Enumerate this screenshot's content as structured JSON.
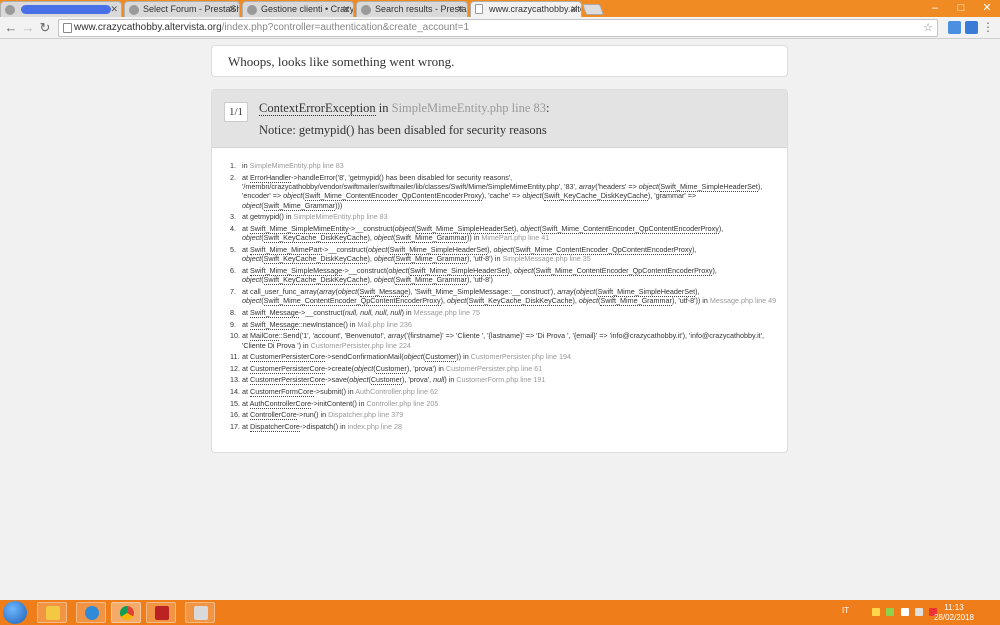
{
  "browser": {
    "tabs": [
      {
        "title": ""
      },
      {
        "title": "Select Forum - PrestaSh"
      },
      {
        "title": "Gestione clienti • Crazy C"
      },
      {
        "title": "Search results - PrestaSh"
      },
      {
        "title": "www.crazycathobby.alterv"
      }
    ],
    "url_host": "www.crazycathobby.altervista.org",
    "url_path": "/index.php?controller=authentication&create_account=1"
  },
  "page": {
    "whoops": "Whoops, looks like something went wrong.",
    "exception": {
      "counter": "1/1",
      "class": "ContextErrorException",
      "in": "in",
      "file": "SimpleMimeEntity.php line 83",
      "colon": ":",
      "message": "Notice: getmypid() has been disabled for security reasons"
    }
  },
  "stack_trace": [
    {
      "n": "1.",
      "parts": [
        [
          "t",
          "in "
        ],
        [
          "g",
          "SimpleMimeEntity.php line 83"
        ]
      ]
    },
    {
      "n": "2.",
      "parts": [
        [
          "t",
          "at "
        ],
        [
          "u",
          "ErrorHandler"
        ],
        [
          "t",
          "->handleError('8', 'getmypid() has been disabled for security reasons', '/membri/crazycathobby/vendor/swiftmailer/swiftmailer/lib/classes/Swift/Mime/SimpleMimeEntity.php', '83', "
        ],
        [
          "i",
          "array"
        ],
        [
          "t",
          "('headers' => "
        ],
        [
          "i",
          "object"
        ],
        [
          "t",
          "("
        ],
        [
          "u",
          "Swift_Mime_SimpleHeaderSet"
        ],
        [
          "t",
          "), 'encoder' => "
        ],
        [
          "i",
          "object"
        ],
        [
          "t",
          "("
        ],
        [
          "u",
          "Swift_Mime_ContentEncoder_QpContentEncoderProxy"
        ],
        [
          "t",
          "), 'cache' => "
        ],
        [
          "i",
          "object"
        ],
        [
          "t",
          "("
        ],
        [
          "u",
          "Swift_KeyCache_DiskKeyCache"
        ],
        [
          "t",
          "), 'grammar' => "
        ],
        [
          "i",
          "object"
        ],
        [
          "t",
          "("
        ],
        [
          "u",
          "Swift_Mime_Grammar"
        ],
        [
          "t",
          ")))"
        ]
      ]
    },
    {
      "n": "3.",
      "parts": [
        [
          "t",
          "at getmypid() in "
        ],
        [
          "g",
          "SimpleMimeEntity.php line 83"
        ]
      ]
    },
    {
      "n": "4.",
      "parts": [
        [
          "t",
          "at "
        ],
        [
          "u",
          "Swift_Mime_SimpleMimeEntity"
        ],
        [
          "t",
          "->__construct("
        ],
        [
          "i",
          "object"
        ],
        [
          "t",
          "("
        ],
        [
          "u",
          "Swift_Mime_SimpleHeaderSet"
        ],
        [
          "t",
          "), "
        ],
        [
          "i",
          "object"
        ],
        [
          "t",
          "("
        ],
        [
          "u",
          "Swift_Mime_ContentEncoder_QpContentEncoderProxy"
        ],
        [
          "t",
          "), "
        ],
        [
          "i",
          "object"
        ],
        [
          "t",
          "("
        ],
        [
          "u",
          "Swift_KeyCache_DiskKeyCache"
        ],
        [
          "t",
          "), "
        ],
        [
          "i",
          "object"
        ],
        [
          "t",
          "("
        ],
        [
          "u",
          "Swift_Mime_Grammar"
        ],
        [
          "t",
          ")) in "
        ],
        [
          "g",
          "MimePart.php line 41"
        ]
      ]
    },
    {
      "n": "5.",
      "parts": [
        [
          "t",
          "at "
        ],
        [
          "u",
          "Swift_Mime_MimePart"
        ],
        [
          "t",
          "->__construct("
        ],
        [
          "i",
          "object"
        ],
        [
          "t",
          "("
        ],
        [
          "u",
          "Swift_Mime_SimpleHeaderSet"
        ],
        [
          "t",
          "), "
        ],
        [
          "i",
          "object"
        ],
        [
          "t",
          "("
        ],
        [
          "u",
          "Swift_Mime_ContentEncoder_QpContentEncoderProxy"
        ],
        [
          "t",
          "), "
        ],
        [
          "i",
          "object"
        ],
        [
          "t",
          "("
        ],
        [
          "u",
          "Swift_KeyCache_DiskKeyCache"
        ],
        [
          "t",
          "), "
        ],
        [
          "i",
          "object"
        ],
        [
          "t",
          "("
        ],
        [
          "u",
          "Swift_Mime_Grammar"
        ],
        [
          "t",
          "), 'utf-8') in "
        ],
        [
          "g",
          "SimpleMessage.php line 35"
        ]
      ]
    },
    {
      "n": "6.",
      "parts": [
        [
          "t",
          "at "
        ],
        [
          "u",
          "Swift_Mime_SimpleMessage"
        ],
        [
          "t",
          "->__construct("
        ],
        [
          "i",
          "object"
        ],
        [
          "t",
          "("
        ],
        [
          "u",
          "Swift_Mime_SimpleHeaderSet"
        ],
        [
          "t",
          "), "
        ],
        [
          "i",
          "object"
        ],
        [
          "t",
          "("
        ],
        [
          "u",
          "Swift_Mime_ContentEncoder_QpContentEncoderProxy"
        ],
        [
          "t",
          "), "
        ],
        [
          "i",
          "object"
        ],
        [
          "t",
          "("
        ],
        [
          "u",
          "Swift_KeyCache_DiskKeyCache"
        ],
        [
          "t",
          "), "
        ],
        [
          "i",
          "object"
        ],
        [
          "t",
          "("
        ],
        [
          "u",
          "Swift_Mime_Grammar"
        ],
        [
          "t",
          "), 'utf-8')"
        ]
      ]
    },
    {
      "n": "7.",
      "parts": [
        [
          "t",
          "at call_user_func_array("
        ],
        [
          "i",
          "array"
        ],
        [
          "t",
          "("
        ],
        [
          "i",
          "object"
        ],
        [
          "t",
          "("
        ],
        [
          "u",
          "Swift_Message"
        ],
        [
          "t",
          "), 'Swift_Mime_SimpleMessage::__construct'), "
        ],
        [
          "i",
          "array"
        ],
        [
          "t",
          "("
        ],
        [
          "i",
          "object"
        ],
        [
          "t",
          "("
        ],
        [
          "u",
          "Swift_Mime_SimpleHeaderSet"
        ],
        [
          "t",
          "), "
        ],
        [
          "i",
          "object"
        ],
        [
          "t",
          "("
        ],
        [
          "u",
          "Swift_Mime_ContentEncoder_QpContentEncoderProxy"
        ],
        [
          "t",
          "), "
        ],
        [
          "i",
          "object"
        ],
        [
          "t",
          "("
        ],
        [
          "u",
          "Swift_KeyCache_DiskKeyCache"
        ],
        [
          "t",
          "), "
        ],
        [
          "i",
          "object"
        ],
        [
          "t",
          "("
        ],
        [
          "u",
          "Swift_Mime_Grammar"
        ],
        [
          "t",
          "), 'utf-8')) in "
        ],
        [
          "g",
          "Message.php line 49"
        ]
      ]
    },
    {
      "n": "8.",
      "parts": [
        [
          "t",
          "at "
        ],
        [
          "u",
          "Swift_Message"
        ],
        [
          "t",
          "->__construct("
        ],
        [
          "i",
          "null, null, null, null"
        ],
        [
          "t",
          ") in "
        ],
        [
          "g",
          "Message.php line 75"
        ]
      ]
    },
    {
      "n": "9.",
      "parts": [
        [
          "t",
          "at "
        ],
        [
          "u",
          "Swift_Message"
        ],
        [
          "t",
          "::newInstance() in "
        ],
        [
          "g",
          "Mail.php line 236"
        ]
      ]
    },
    {
      "n": "10.",
      "parts": [
        [
          "t",
          "at "
        ],
        [
          "u",
          "MailCore"
        ],
        [
          "t",
          "::Send('1', 'account', 'Benvenuto!', "
        ],
        [
          "i",
          "array"
        ],
        [
          "t",
          "('{firstname}' => 'Cliente ', '{lastname}' => 'Di Prova ', '{email}' => 'info@crazycathobby.it'), 'info@crazycathobby.it', 'Cliente Di Prova ') in "
        ],
        [
          "g",
          "CustomerPersister.php line 224"
        ]
      ]
    },
    {
      "n": "11.",
      "parts": [
        [
          "t",
          "at "
        ],
        [
          "u",
          "CustomerPersisterCore"
        ],
        [
          "t",
          "->sendConfirmationMail("
        ],
        [
          "i",
          "object"
        ],
        [
          "t",
          "("
        ],
        [
          "u",
          "Customer"
        ],
        [
          "t",
          ")) in "
        ],
        [
          "g",
          "CustomerPersister.php line 194"
        ]
      ]
    },
    {
      "n": "12.",
      "parts": [
        [
          "t",
          "at "
        ],
        [
          "u",
          "CustomerPersisterCore"
        ],
        [
          "t",
          "->create("
        ],
        [
          "i",
          "object"
        ],
        [
          "t",
          "("
        ],
        [
          "u",
          "Customer"
        ],
        [
          "t",
          "), 'prova') in "
        ],
        [
          "g",
          "CustomerPersister.php line 61"
        ]
      ]
    },
    {
      "n": "13.",
      "parts": [
        [
          "t",
          "at "
        ],
        [
          "u",
          "CustomerPersisterCore"
        ],
        [
          "t",
          "->save("
        ],
        [
          "i",
          "object"
        ],
        [
          "t",
          "("
        ],
        [
          "u",
          "Customer"
        ],
        [
          "t",
          "), 'prova', "
        ],
        [
          "i",
          "null"
        ],
        [
          "t",
          ") in "
        ],
        [
          "g",
          "CustomerForm.php line 191"
        ]
      ]
    },
    {
      "n": "14.",
      "parts": [
        [
          "t",
          "at "
        ],
        [
          "u",
          "CustomerFormCore"
        ],
        [
          "t",
          "->submit() in "
        ],
        [
          "g",
          "AuthController.php line 62"
        ]
      ]
    },
    {
      "n": "15.",
      "parts": [
        [
          "t",
          "at "
        ],
        [
          "u",
          "AuthControllerCore"
        ],
        [
          "t",
          "->initContent() in "
        ],
        [
          "g",
          "Controller.php line 205"
        ]
      ]
    },
    {
      "n": "16.",
      "parts": [
        [
          "t",
          "at "
        ],
        [
          "u",
          "ControllerCore"
        ],
        [
          "t",
          "->run() in "
        ],
        [
          "g",
          "Dispatcher.php line 379"
        ]
      ]
    },
    {
      "n": "17.",
      "parts": [
        [
          "t",
          "at "
        ],
        [
          "u",
          "DispatcherCore"
        ],
        [
          "t",
          "->dispatch() in "
        ],
        [
          "g",
          "index.php line 28"
        ]
      ]
    }
  ],
  "taskbar": {
    "language": "IT",
    "time": "11:13",
    "date": "28/02/2018",
    "apps": [
      "folder-icon",
      "internet-explorer-icon",
      "chrome-icon",
      "filezilla-icon",
      "paint-icon"
    ]
  },
  "colors": {
    "accent_orange": "#ef8b22",
    "taskbar_orange": "#ee7d1a",
    "error_header_bg": "#e3e3e3"
  }
}
